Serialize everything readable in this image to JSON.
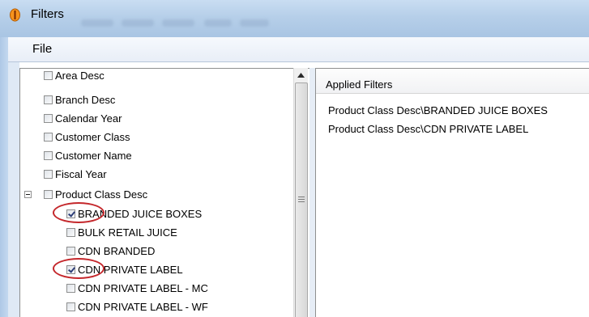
{
  "window": {
    "title": "Filters",
    "menu": [
      "File"
    ]
  },
  "tree": {
    "items": [
      {
        "label": "Area Desc",
        "checked": false
      },
      {
        "label": "Branch Desc",
        "checked": false
      },
      {
        "label": "Calendar Year",
        "checked": false
      },
      {
        "label": "Customer Class",
        "checked": false
      },
      {
        "label": "Customer Name",
        "checked": false
      },
      {
        "label": "Fiscal Year",
        "checked": false
      },
      {
        "label": "Product Class Desc",
        "checked": false,
        "expanded": true
      }
    ],
    "children": [
      {
        "label": "BRANDED JUICE BOXES",
        "checked": true,
        "highlighted": true
      },
      {
        "label": "BULK RETAIL JUICE",
        "checked": false
      },
      {
        "label": "CDN BRANDED",
        "checked": false
      },
      {
        "label": "CDN PRIVATE LABEL",
        "checked": true,
        "highlighted": true
      },
      {
        "label": "CDN PRIVATE LABEL - MC",
        "checked": false
      },
      {
        "label": "CDN PRIVATE LABEL - WF",
        "checked": false
      }
    ]
  },
  "applied_filters": {
    "header": "Applied Filters",
    "items": [
      "Product Class Desc\\BRANDED JUICE BOXES",
      "Product Class Desc\\CDN PRIVATE LABEL"
    ]
  },
  "colors": {
    "titlebar": "#b6cfe9",
    "annotation": "#c4272b",
    "checkmark": "#2c3e78"
  }
}
